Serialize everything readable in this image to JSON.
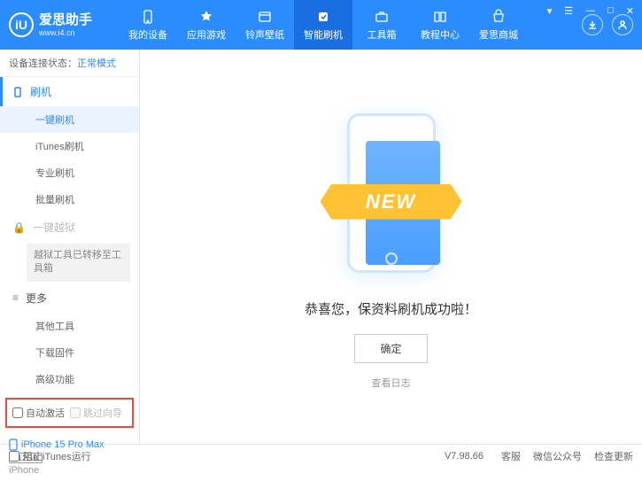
{
  "app": {
    "title": "爱思助手",
    "subtitle": "www.i4.cn",
    "logoLetter": "iU"
  },
  "nav": {
    "items": [
      {
        "label": "我的设备"
      },
      {
        "label": "应用游戏"
      },
      {
        "label": "铃声壁纸"
      },
      {
        "label": "智能刷机"
      },
      {
        "label": "工具箱"
      },
      {
        "label": "教程中心"
      },
      {
        "label": "爱思商城"
      }
    ]
  },
  "status": {
    "label": "设备连接状态：",
    "value": "正常模式"
  },
  "sidebar": {
    "flash": {
      "title": "刷机",
      "items": [
        "一键刷机",
        "iTunes刷机",
        "专业刷机",
        "批量刷机"
      ]
    },
    "jailbreak": {
      "title": "一键越狱",
      "note": "越狱工具已转移至工具箱"
    },
    "more": {
      "title": "更多",
      "items": [
        "其他工具",
        "下载固件",
        "高级功能"
      ]
    }
  },
  "checkboxes": {
    "autoActivate": "自动激活",
    "skipGuide": "跳过向导"
  },
  "device": {
    "name": "iPhone 15 Pro Max",
    "storage": "512GB",
    "type": "iPhone"
  },
  "main": {
    "ribbon": "NEW",
    "success": "恭喜您，保资料刷机成功啦！",
    "confirm": "确定",
    "logLink": "查看日志"
  },
  "footer": {
    "blockItunes": "阻止iTunes运行",
    "version": "V7.98.66",
    "links": [
      "客服",
      "微信公众号",
      "检查更新"
    ]
  }
}
